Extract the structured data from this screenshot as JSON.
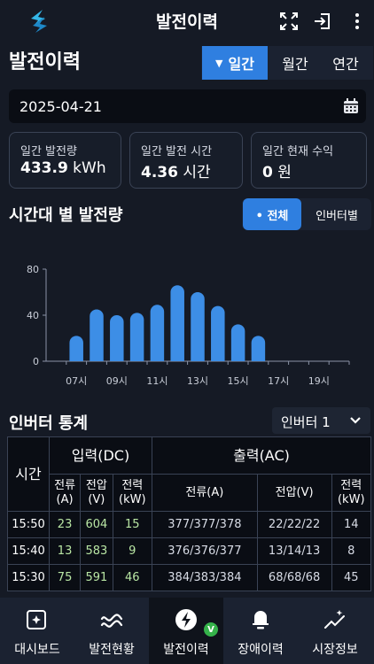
{
  "app": {
    "title": "발전이력"
  },
  "page": {
    "title": "발전이력"
  },
  "period_tabs": [
    {
      "label": "일간",
      "active": true
    },
    {
      "label": "월간",
      "active": false
    },
    {
      "label": "연간",
      "active": false
    }
  ],
  "date": {
    "value": "2025-04-21"
  },
  "summary": [
    {
      "label": "일간 발전량",
      "value": "433.9",
      "unit": " kWh"
    },
    {
      "label": "일간 발전 시간",
      "value": "4.36",
      "unit": " 시간"
    },
    {
      "label": "일간 현재 수익",
      "value": "0",
      "unit": " 원"
    }
  ],
  "hourly_section": {
    "title": "시간대 별 발전량",
    "toggle": [
      {
        "label": "• 전체",
        "active": true
      },
      {
        "label": "인버터별",
        "active": false
      }
    ]
  },
  "chart_data": {
    "type": "bar",
    "categories": [
      "06시",
      "07시",
      "08시",
      "09시",
      "10시",
      "11시",
      "12시",
      "13시",
      "14시",
      "15시",
      "16시",
      "17시",
      "18시",
      "19시",
      "20시"
    ],
    "x_tick_labels": [
      "07시",
      "09시",
      "11시",
      "13시",
      "15시",
      "17시",
      "19시"
    ],
    "values": [
      0,
      22,
      45,
      40,
      42,
      49,
      66,
      60,
      48,
      32,
      22,
      0,
      0,
      0,
      0
    ],
    "ylim": [
      0,
      80
    ],
    "y_ticks": [
      0,
      40,
      80
    ],
    "color": "#3d8ee6",
    "grid": false
  },
  "inverter_section": {
    "title": "인버터 통계",
    "select_value": "인버터 1"
  },
  "table": {
    "time_header": "시간",
    "input_header": "입력(DC)",
    "output_header": "출력(AC)",
    "sub_headers": [
      "전류\n(A)",
      "전압\n(V)",
      "전력\n(kW)",
      "전류(A)",
      "전압(V)",
      "전력\n(kW)"
    ],
    "rows": [
      {
        "time": "15:50",
        "in_a": "23",
        "in_v": "604",
        "in_kw": "15",
        "out_a": "377/377/378",
        "out_v": "22/22/22",
        "out_kw": "14"
      },
      {
        "time": "15:40",
        "in_a": "13",
        "in_v": "583",
        "in_kw": "9",
        "out_a": "376/376/377",
        "out_v": "13/14/13",
        "out_kw": "8"
      },
      {
        "time": "15:30",
        "in_a": "75",
        "in_v": "591",
        "in_kw": "46",
        "out_a": "384/383/384",
        "out_v": "68/68/68",
        "out_kw": "45"
      }
    ]
  },
  "bottom_nav": [
    {
      "label": "대시보드",
      "icon": "dashboard-sparkle-icon",
      "active": false
    },
    {
      "label": "발전현황",
      "icon": "wave-chart-icon",
      "active": false
    },
    {
      "label": "발전이력",
      "icon": "lightning-icon",
      "active": true,
      "badge": "V"
    },
    {
      "label": "장애이력",
      "icon": "alarm-bell-icon",
      "active": false
    },
    {
      "label": "시장정보",
      "icon": "sparkle-trend-icon",
      "active": false
    }
  ],
  "colors": {
    "accent": "#2f7fe0",
    "background": "#151a25",
    "badge": "#35b24a",
    "bar": "#3d8ee6"
  }
}
